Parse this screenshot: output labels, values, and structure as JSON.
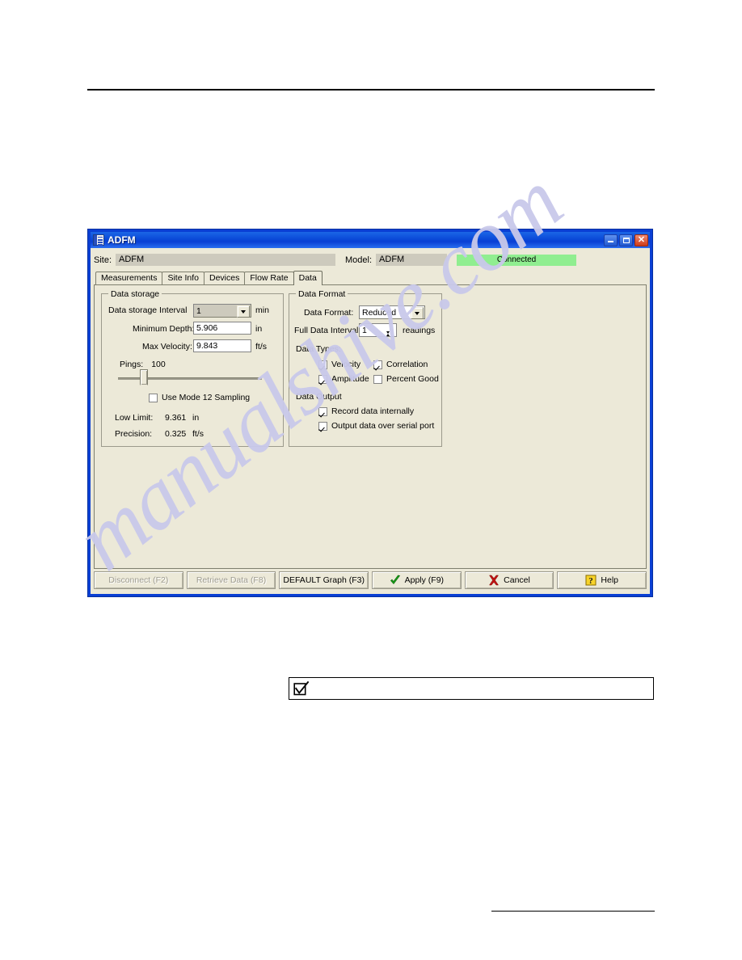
{
  "window": {
    "title": "ADFM",
    "icon": "list-window-icon",
    "titlebar_color": "#0a3fd4",
    "body_color": "#ece9d8",
    "buttons": {
      "minimize": "minimize-icon",
      "maximize": "maximize-icon",
      "close": "close-icon"
    }
  },
  "identity": {
    "site_label": "Site:",
    "site_value": "ADFM",
    "model_label": "Model:",
    "model_value": "ADFM",
    "status": "Connected",
    "status_color": "#90ee90"
  },
  "tabs": [
    {
      "label": "Measurements",
      "active": false
    },
    {
      "label": "Site Info",
      "active": false
    },
    {
      "label": "Devices",
      "active": false
    },
    {
      "label": "Flow Rate",
      "active": false
    },
    {
      "label": "Data",
      "active": true
    }
  ],
  "data_storage": {
    "group_title": "Data storage",
    "interval_label": "Data storage Interval",
    "interval_value": "1",
    "interval_unit": "min",
    "min_depth_label": "Minimum Depth:",
    "min_depth_value": "5.906",
    "min_depth_unit": "in",
    "max_velocity_label": "Max Velocity:",
    "max_velocity_value": "9.843",
    "max_velocity_unit": "ft/s",
    "pings_label": "Pings:",
    "pings_value": "100",
    "pings_slider_percent": 18,
    "mode12_label": "Use Mode 12 Sampling",
    "mode12_checked": false,
    "low_limit_label": "Low Limit:",
    "low_limit_value": "9.361",
    "low_limit_unit": "in",
    "precision_label": "Precision:",
    "precision_value": "0.325",
    "precision_unit": "ft/s"
  },
  "data_format": {
    "group_title": "Data Format",
    "format_label": "Data Format:",
    "format_value": "Reduced",
    "full_interval_label": "Full Data Interval:",
    "full_interval_value": "1",
    "full_interval_unit": "readings",
    "data_types_label": "Data Types:",
    "types": [
      {
        "label": "Velocity",
        "checked": true
      },
      {
        "label": "Correlation",
        "checked": true
      },
      {
        "label": "Amplitude",
        "checked": true
      },
      {
        "label": "Percent Good",
        "checked": false
      }
    ],
    "data_output_label": "Data Output",
    "outputs": [
      {
        "label": "Record data internally",
        "checked": true
      },
      {
        "label": "Output data over serial port",
        "checked": true
      }
    ]
  },
  "buttonbar": [
    {
      "label": "Disconnect (F2)",
      "icon": null,
      "disabled": true
    },
    {
      "label": "Retrieve Data (F8)",
      "icon": null,
      "disabled": true
    },
    {
      "label": "DEFAULT Graph (F3)",
      "icon": null,
      "disabled": false
    },
    {
      "label": "Apply (F9)",
      "icon": "green-check-icon",
      "disabled": false
    },
    {
      "label": "Cancel",
      "icon": "red-x-icon",
      "disabled": false
    },
    {
      "label": "Help",
      "icon": "yellow-question-icon",
      "disabled": false
    }
  ],
  "note_box": {
    "icon": "checkmark-icon",
    "text": ""
  },
  "watermark": {
    "text": "manualshive.com",
    "color": "#c9c9ea"
  }
}
